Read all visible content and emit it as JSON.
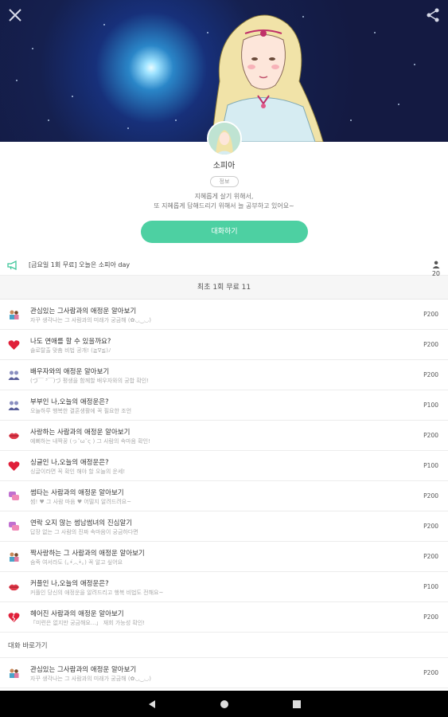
{
  "profile": {
    "name": "소피아",
    "badge": "정보",
    "description_line1": "지혜롭게 살기 위해서,",
    "description_line2": "또 지혜롭게 답해드리기 위해서 늘 공부하고 있어요~",
    "chat_button": "대화하기"
  },
  "notice": {
    "text": "[금요일 1회 무료] 오늘은 소피아 day",
    "count": "20"
  },
  "section_header": "최초 1회 무료 11",
  "items": [
    {
      "icon": "couple-icon",
      "title": "관심있는 그사람과의 애정운 알아보기",
      "subtitle": "자꾸 생각나는 그 사람과의 미래가 궁금해 (✿◡‿◡)",
      "price": "P200"
    },
    {
      "icon": "heart-icon",
      "title": "나도 연애를 할 수 있을까요?",
      "subtitle": "솔로탈출 맞춤 비법 공개! (≧∇≦)ﾉ",
      "price": "P200"
    },
    {
      "icon": "couple-icon",
      "title": "배우자와의 애정운 알아보기",
      "subtitle": "(づ￣ ³￣)づ 평생을 함께할 배우자와의 궁합 확인!",
      "price": "P200"
    },
    {
      "icon": "couple-icon",
      "title": "부부인 나,오늘의 애정운은?",
      "subtitle": "오늘하루 행복한 결혼생활에 꼭 필요한 조언",
      "price": "P100"
    },
    {
      "icon": "lips-icon",
      "title": "사랑하는 사람과의 애정운 알아보기",
      "subtitle": "예뻐하는 내짝꿍 (っ˘ω˘ς ) 그 사람의 속마음 확인!",
      "price": "P200"
    },
    {
      "icon": "heart-icon",
      "title": "싱글인 나,오늘의 애정운은?",
      "subtitle": "싱글이라면 꼭 확인 해야 할 오늘의 운세!",
      "price": "P100"
    },
    {
      "icon": "chat-icon",
      "title": "썸타는 사람과의 애정운 알아보기",
      "subtitle": "썸! ♥ 그 사람 마음 ♥ 어떨지 알려드려요~",
      "price": "P200"
    },
    {
      "icon": "chat-icon",
      "title": "연락 오지 않는 썸남썸녀의 진심알기",
      "subtitle": "답장 없는 그 사람의 진짜 속마음이 궁금하다면",
      "price": "P200"
    },
    {
      "icon": "couple-icon",
      "title": "짝사랑하는 그 사람과의 애정운 알아보기",
      "subtitle": "숨죽 여서라도 (｡•́︿•̀｡) 꼭 알고 싶어요",
      "price": "P200"
    },
    {
      "icon": "lips-icon",
      "title": "커플인 나,오늘의 애정운은?",
      "subtitle": "커플인 당신의 애정운을 알려드리고 행복 비법도 전해요~",
      "price": "P100"
    },
    {
      "icon": "broken-heart-icon",
      "title": "헤어진 사람과의 애정운 알아보기",
      "subtitle": "「미련은 없지만 궁금해요...」 재회 가능성 확인!",
      "price": "P200"
    }
  ],
  "more_header": "대화 바로가기",
  "more_items": [
    {
      "icon": "couple-icon",
      "title": "관심있는 그사람과의 애정운 알아보기",
      "subtitle": "자꾸 생각나는 그 사람과의 미래가 궁금해 (✿◡‿◡)",
      "price": "P200"
    }
  ],
  "colors": {
    "accent": "#4dd0a2",
    "hero_background": "#141a42",
    "navbar": "#000000"
  },
  "icons": {
    "close": "close-icon",
    "share": "share-icon",
    "notice": "megaphone-icon",
    "people": "people-icon",
    "nav_back": "back-triangle-icon",
    "nav_home": "home-circle-icon",
    "nav_recents": "recents-square-icon"
  }
}
